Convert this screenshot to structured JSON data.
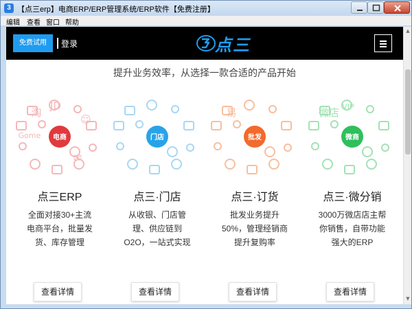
{
  "window": {
    "title": "【点三erp】电商ERP/ERP管理系统/ERP软件【免费注册】",
    "app_icon_glyph": "3"
  },
  "menu": [
    "编辑",
    "查看",
    "窗口",
    "帮助"
  ],
  "header": {
    "trial_label": "免费试用",
    "login_label": "登录",
    "logo_text": "点三",
    "menu_icon": "hamburger-icon"
  },
  "tagline": "提升业务效率，从选择一款合适的产品开始",
  "products": [
    {
      "name": "点三ERP",
      "badge": "电商",
      "accent": "#e03a3e",
      "light": "#f4b7b9",
      "icon_glyphs": [
        "淘",
        "JD",
        "Gome",
        "☺",
        "✉"
      ],
      "desc": [
        "全面对接30+主流",
        "电商平台，批量发",
        "货、库存管理"
      ],
      "button_label": "查看详情"
    },
    {
      "name": "点三·门店",
      "badge": "门店",
      "accent": "#29a3e8",
      "light": "#a8d7f4",
      "icon_glyphs": [],
      "desc": [
        "从收银、门店管",
        "理、供应链到",
        "O2O，一站式实现"
      ],
      "button_label": "查看详情"
    },
    {
      "name": "点三·订货",
      "badge": "批发",
      "accent": "#f26a2d",
      "light": "#f7bf9f",
      "icon_glyphs": [
        "易"
      ],
      "desc": [
        "批发业务提升",
        "50%，管理经销商",
        "提升复购率"
      ],
      "button_label": "查看详情"
    },
    {
      "name": "点三·微分销",
      "badge": "微商",
      "accent": "#2fbf5c",
      "light": "#a3e2b5",
      "icon_glyphs": [
        "微店",
        "VIP"
      ],
      "desc": [
        "3000万微店店主帮",
        "你销售，自带功能",
        "强大的ERP"
      ],
      "button_label": "查看详情"
    }
  ]
}
